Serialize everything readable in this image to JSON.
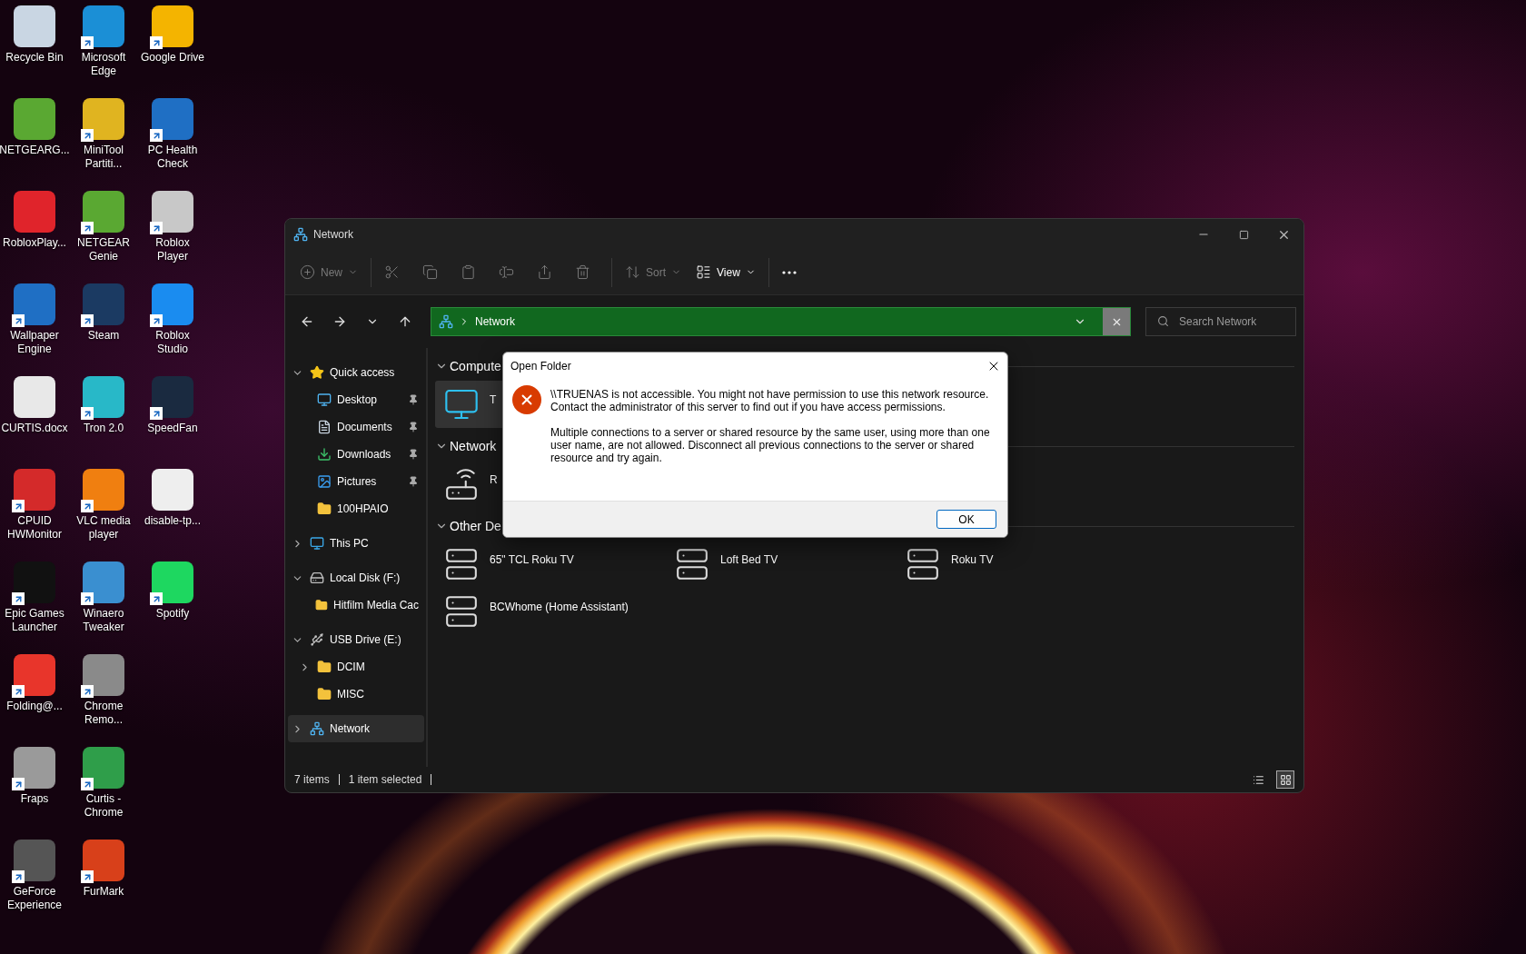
{
  "desktop_icons": [
    {
      "label": "Recycle Bin",
      "color": "#c9d6e3",
      "shortcut": false
    },
    {
      "label": "NETGEARG...",
      "color": "#5aa832",
      "shortcut": false
    },
    {
      "label": "RobloxPlay...",
      "color": "#e0242b",
      "shortcut": false
    },
    {
      "label": "Wallpaper Engine",
      "color": "#1f6fc4",
      "shortcut": true
    },
    {
      "label": "CURTIS.docx",
      "color": "#e8e8e8",
      "shortcut": false
    },
    {
      "label": "CPUID HWMonitor",
      "color": "#d42a2a",
      "shortcut": true
    },
    {
      "label": "Epic Games Launcher",
      "color": "#111111",
      "shortcut": true
    },
    {
      "label": "Folding@...",
      "color": "#e8352b",
      "shortcut": true
    },
    {
      "label": "Fraps",
      "color": "#9a9a9a",
      "shortcut": true
    },
    {
      "label": "GeForce Experience",
      "color": "#555555",
      "shortcut": true
    },
    {
      "label": "Microsoft Edge",
      "color": "#1b8fd6",
      "shortcut": true
    },
    {
      "label": "MiniTool Partiti...",
      "color": "#e0b420",
      "shortcut": true
    },
    {
      "label": "NETGEAR Genie",
      "color": "#5aa832",
      "shortcut": true
    },
    {
      "label": "Steam",
      "color": "#1b3a62",
      "shortcut": true
    },
    {
      "label": "Tron 2.0",
      "color": "#28b8c8",
      "shortcut": true
    },
    {
      "label": "VLC media player",
      "color": "#f07f10",
      "shortcut": true
    },
    {
      "label": "Winaero Tweaker",
      "color": "#3a8fd0",
      "shortcut": true
    },
    {
      "label": "Chrome Remo...",
      "color": "#8a8a8a",
      "shortcut": true
    },
    {
      "label": "Curtis - Chrome",
      "color": "#2f9e4a",
      "shortcut": true
    },
    {
      "label": "FurMark",
      "color": "#d8401a",
      "shortcut": true
    },
    {
      "label": "Google Drive",
      "color": "#f4b400",
      "shortcut": true
    },
    {
      "label": "PC Health Check",
      "color": "#1f6fc4",
      "shortcut": true
    },
    {
      "label": "Roblox Player",
      "color": "#c8c8c8",
      "shortcut": true
    },
    {
      "label": "Roblox Studio",
      "color": "#1a8cf0",
      "shortcut": true
    },
    {
      "label": "SpeedFan",
      "color": "#1a2a40",
      "shortcut": true
    },
    {
      "label": "disable-tp...",
      "color": "#eeeeee",
      "shortcut": false
    },
    {
      "label": "Spotify",
      "color": "#1ed760",
      "shortcut": true
    }
  ],
  "window": {
    "title": "Network",
    "toolbar": [
      [
        {
          "kind": "new",
          "label": "New",
          "disabled": true
        }
      ],
      [
        {
          "kind": "cut",
          "disabled": true
        },
        {
          "kind": "copy",
          "disabled": true
        },
        {
          "kind": "paste",
          "disabled": true
        },
        {
          "kind": "rename",
          "disabled": true
        },
        {
          "kind": "share",
          "disabled": true
        },
        {
          "kind": "delete",
          "disabled": true
        }
      ],
      [
        {
          "kind": "sort",
          "label": "Sort",
          "disabled": true
        },
        {
          "kind": "view",
          "label": "View",
          "disabled": false
        }
      ],
      [
        {
          "kind": "more",
          "disabled": false
        }
      ]
    ],
    "address": {
      "path": "Network"
    },
    "search": {
      "placeholder": "Search Network"
    },
    "sidebar": [
      {
        "label": "Quick access",
        "kind": "star",
        "expanded": true,
        "selected": false,
        "children": [
          {
            "label": "Desktop",
            "kind": "desktop",
            "pinned": true,
            "selected": false
          },
          {
            "label": "Documents",
            "kind": "documents",
            "pinned": true,
            "selected": false
          },
          {
            "label": "Downloads",
            "kind": "downloads",
            "pinned": true,
            "selected": false
          },
          {
            "label": "Pictures",
            "kind": "pictures",
            "pinned": true,
            "selected": false
          },
          {
            "label": "100HPAIO",
            "kind": "folder",
            "pinned": false,
            "selected": false
          }
        ]
      },
      {
        "label": "This PC",
        "kind": "pc",
        "expanded": false,
        "selected": false
      },
      {
        "label": "Local Disk (F:)",
        "kind": "disk",
        "expanded": true,
        "selected": false,
        "children": [
          {
            "label": "Hitfilm Media Cac",
            "kind": "folder",
            "pinned": false,
            "selected": false
          }
        ]
      },
      {
        "label": "USB Drive (E:)",
        "kind": "usb",
        "expanded": true,
        "selected": false,
        "children": [
          {
            "label": "DCIM",
            "kind": "folder",
            "expanded": false,
            "pinned": false,
            "selected": false
          },
          {
            "label": "MISC",
            "kind": "folder",
            "pinned": false,
            "selected": false
          }
        ]
      },
      {
        "label": "Network",
        "kind": "network",
        "expanded": false,
        "selected": true
      }
    ],
    "groups": [
      {
        "title": "Compute",
        "expanded": true,
        "items": [
          {
            "label": "T",
            "kind": "computer",
            "selected": true
          }
        ]
      },
      {
        "title": "Network",
        "expanded": true,
        "items": [
          {
            "label": "R",
            "kind": "router",
            "selected": false
          }
        ]
      },
      {
        "title": "Other De",
        "expanded": true,
        "items": [
          {
            "label": "65\" TCL Roku TV",
            "kind": "device",
            "selected": false
          },
          {
            "label": "Loft Bed TV",
            "kind": "device",
            "selected": false
          },
          {
            "label": "Roku TV",
            "kind": "device",
            "selected": false
          },
          {
            "label": "BCWhome (Home Assistant)",
            "kind": "device",
            "selected": false
          }
        ]
      }
    ],
    "status_bar": {
      "count": "7 items",
      "selection": "1 item selected",
      "views": [
        {
          "kind": "details",
          "selected": false
        },
        {
          "kind": "tiles",
          "selected": true
        }
      ]
    }
  },
  "dialog": {
    "title": "Open Folder",
    "paragraphs": [
      "\\\\TRUENAS is not accessible. You might not have permission to use this network resource. Contact the administrator of this server to find out if you have access permissions.",
      "Multiple connections to a server or shared resource by the same user, using more than one user name, are not allowed. Disconnect all previous connections to the server or shared resource and try again."
    ],
    "button": "OK"
  }
}
